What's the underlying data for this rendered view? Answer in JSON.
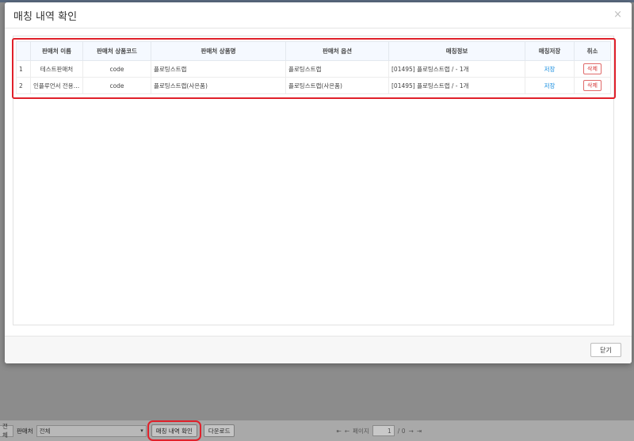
{
  "modal": {
    "title": "매칭 내역 확인",
    "close_icon": "×",
    "close_button": "닫기"
  },
  "table": {
    "columns": [
      "",
      "판매처 이름",
      "판매처 상품코드",
      "판매처 상품명",
      "판매처 옵션",
      "매칭정보",
      "매칭저장",
      "취소"
    ],
    "rows": [
      {
        "no": "1",
        "seller_name": "테스트판매처",
        "product_code": "code",
        "product_name": "플로팅스트랩",
        "option": "플로팅스트랩",
        "match_info": "[01495] 플로팅스트랩 / - 1개",
        "save": "저장",
        "cancel": "삭제"
      },
      {
        "no": "2",
        "seller_name": "인플루언서 전용 ...",
        "product_code": "code",
        "product_name": "플로팅스트랩(사은품)",
        "option": "플로팅스트랩(사은품)",
        "match_info": "[01495] 플로팅스트랩 / - 1개",
        "save": "저장",
        "cancel": "삭제"
      }
    ]
  },
  "bottom_bar": {
    "filter_select_left": "전체",
    "seller_label": "판매처",
    "seller_select": "전체",
    "match_confirm_button": "매칭 내역 확인",
    "download_button": "다운로드",
    "page_label": "페이지",
    "page_value": "1",
    "page_total": "/ 0",
    "first_icon": "⇤",
    "prev_icon": "←",
    "next_icon": "→",
    "last_icon": "⇥"
  },
  "colors": {
    "highlight": "#e0202a",
    "link": "#1a8fe0",
    "danger": "#d53434"
  }
}
